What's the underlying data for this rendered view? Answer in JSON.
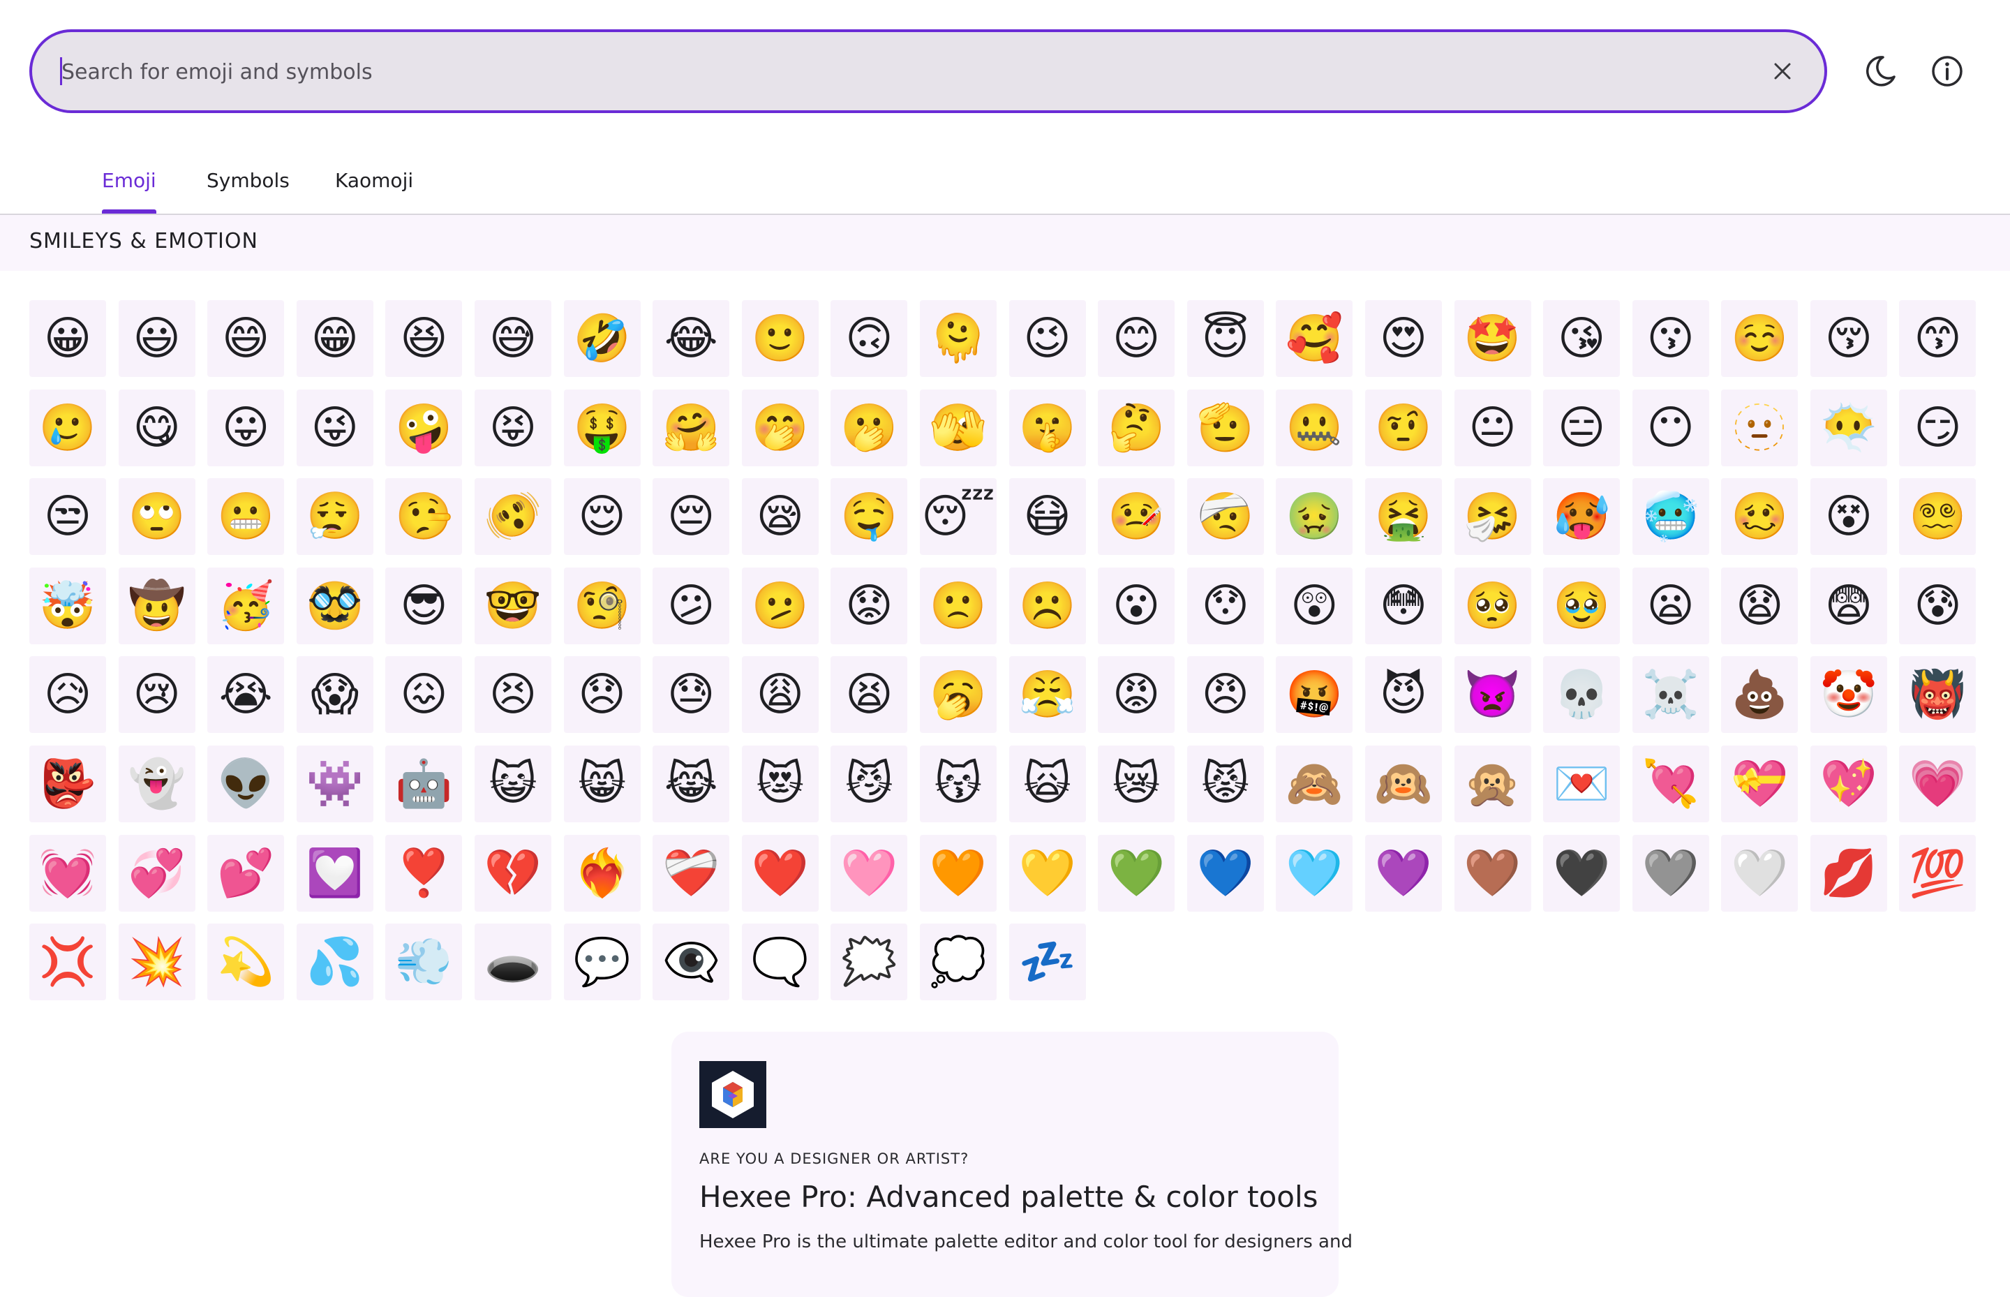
{
  "search": {
    "placeholder": "Search for emoji and symbols",
    "value": "",
    "clear_icon": "close-icon"
  },
  "toolbar": {
    "theme_icon": "moon-icon",
    "info_icon": "info-icon"
  },
  "tabs": [
    {
      "label": "Emoji",
      "active": true
    },
    {
      "label": "Symbols",
      "active": false
    },
    {
      "label": "Kaomoji",
      "active": false
    }
  ],
  "section": {
    "title": "SMILEYS & EMOTION"
  },
  "emojis": [
    "😀",
    "😃",
    "😄",
    "😁",
    "😆",
    "😅",
    "🤣",
    "😂",
    "🙂",
    "🙃",
    "🫠",
    "😉",
    "😊",
    "😇",
    "🥰",
    "😍",
    "🤩",
    "😘",
    "😗",
    "☺️",
    "😚",
    "😙",
    "🥲",
    "😋",
    "😛",
    "😜",
    "🤪",
    "😝",
    "🤑",
    "🤗",
    "🤭",
    "🫢",
    "🫣",
    "🤫",
    "🤔",
    "🫡",
    "🤐",
    "🤨",
    "😐",
    "😑",
    "😶",
    "🫥",
    "😶‍🌫️",
    "😏",
    "😒",
    "🙄",
    "😬",
    "😮‍💨",
    "🤥",
    "🫨",
    "😌",
    "😔",
    "😪",
    "🤤",
    "😴",
    "😷",
    "🤒",
    "🤕",
    "🤢",
    "🤮",
    "🤧",
    "🥵",
    "🥶",
    "🥴",
    "😵",
    "😵‍💫",
    "🤯",
    "🤠",
    "🥳",
    "🥸",
    "😎",
    "🤓",
    "🧐",
    "😕",
    "🫤",
    "😟",
    "🙁",
    "☹️",
    "😮",
    "😯",
    "😲",
    "😳",
    "🥺",
    "🥹",
    "😦",
    "😧",
    "😨",
    "😰",
    "😥",
    "😢",
    "😭",
    "😱",
    "😖",
    "😣",
    "😞",
    "😓",
    "😩",
    "😫",
    "🥱",
    "😤",
    "😡",
    "😠",
    "🤬",
    "😈",
    "👿",
    "💀",
    "☠️",
    "💩",
    "🤡",
    "👹",
    "👺",
    "👻",
    "👽",
    "👾",
    "🤖",
    "😺",
    "😸",
    "😹",
    "😻",
    "😼",
    "😽",
    "🙀",
    "😿",
    "😾",
    "🙈",
    "🙉",
    "🙊",
    "💌",
    "💘",
    "💝",
    "💖",
    "💗",
    "💓",
    "💞",
    "💕",
    "💟",
    "❣️",
    "💔",
    "❤️‍🔥",
    "❤️‍🩹",
    "❤️",
    "🩷",
    "🧡",
    "💛",
    "💚",
    "💙",
    "🩵",
    "💜",
    "🤎",
    "🖤",
    "🩶",
    "🤍",
    "💋",
    "💯",
    "💢",
    "💥",
    "💫",
    "💦",
    "💨",
    "🕳️",
    "💬",
    "👁️‍🗨️",
    "🗨️",
    "🗯️",
    "💭",
    "💤"
  ],
  "promo": {
    "eyebrow": "ARE YOU A DESIGNER OR ARTIST?",
    "title": "Hexee Pro: Advanced palette & color tools",
    "description": "Hexee Pro is the ultimate palette editor and color tool for designers and",
    "logo_icon": "hexee-logo-icon"
  },
  "colors": {
    "accent": "#6a2bd6",
    "search_bg": "#e7e3ea",
    "cell_bg": "#f8f2fb",
    "section_bg": "#faf5fd",
    "logo_bg": "#151c2e"
  }
}
